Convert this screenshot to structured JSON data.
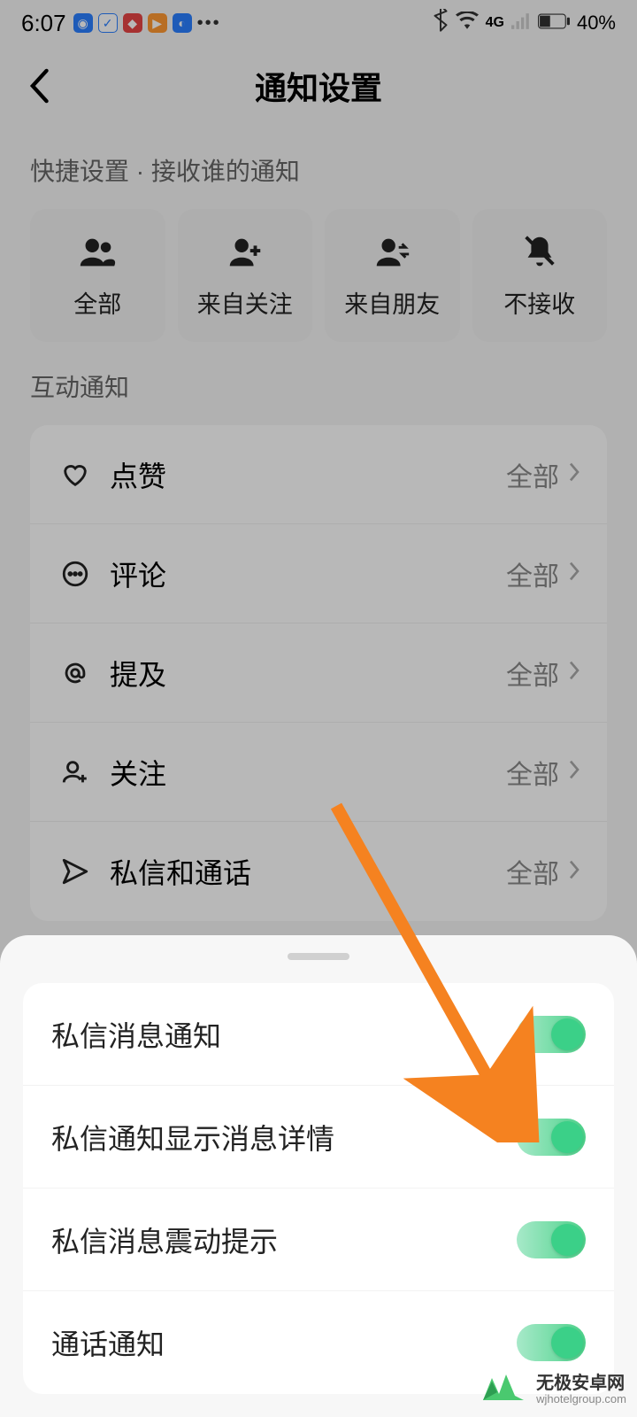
{
  "status": {
    "time": "6:07",
    "battery": "40%",
    "network": "4G"
  },
  "header": {
    "title": "通知设置"
  },
  "quick": {
    "label": "快捷设置 · 接收谁的通知",
    "items": [
      {
        "label": "全部"
      },
      {
        "label": "来自关注"
      },
      {
        "label": "来自朋友"
      },
      {
        "label": "不接收"
      }
    ]
  },
  "interaction": {
    "label": "互动通知",
    "items": [
      {
        "label": "点赞",
        "value": "全部"
      },
      {
        "label": "评论",
        "value": "全部"
      },
      {
        "label": "提及",
        "value": "全部"
      },
      {
        "label": "关注",
        "value": "全部"
      },
      {
        "label": "私信和通话",
        "value": "全部"
      }
    ]
  },
  "sheet": {
    "items": [
      {
        "label": "私信消息通知",
        "on": true
      },
      {
        "label": "私信通知显示消息详情",
        "on": true
      },
      {
        "label": "私信消息震动提示",
        "on": true
      },
      {
        "label": "通话通知",
        "on": true
      }
    ]
  },
  "watermark": {
    "cn": "无极安卓网",
    "en": "wjhotelgroup.com"
  },
  "colors": {
    "toggle_on": "#3bd088",
    "arrow": "#f58220"
  }
}
